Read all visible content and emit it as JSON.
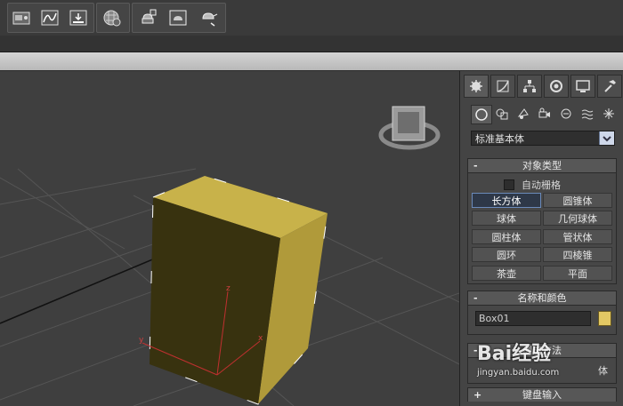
{
  "panel": {
    "category_dropdown": {
      "value": "标准基本体"
    },
    "object_type": {
      "title": "对象类型",
      "sign": "-",
      "auto_grid_label": "自动栅格",
      "buttons": [
        "长方体",
        "圆锥体",
        "球体",
        "几何球体",
        "圆柱体",
        "管状体",
        "圆环",
        "四棱锥",
        "茶壶",
        "平面"
      ]
    },
    "name_color": {
      "title": "名称和颜色",
      "sign": "-",
      "name_value": "Box01",
      "color": "#e3c864"
    },
    "creation_method": {
      "title": "创建方法",
      "sign": "-",
      "partial_label": "体"
    },
    "keyboard_entry": {
      "title": "键盘输入",
      "sign": "+"
    }
  },
  "viewport": {
    "axis_labels": {
      "z": "z",
      "y": "y",
      "x": "x"
    },
    "object_color": "#c8b24a"
  },
  "watermark": {
    "main": "Bai经验",
    "sub": "jingyan.baidu.com"
  }
}
